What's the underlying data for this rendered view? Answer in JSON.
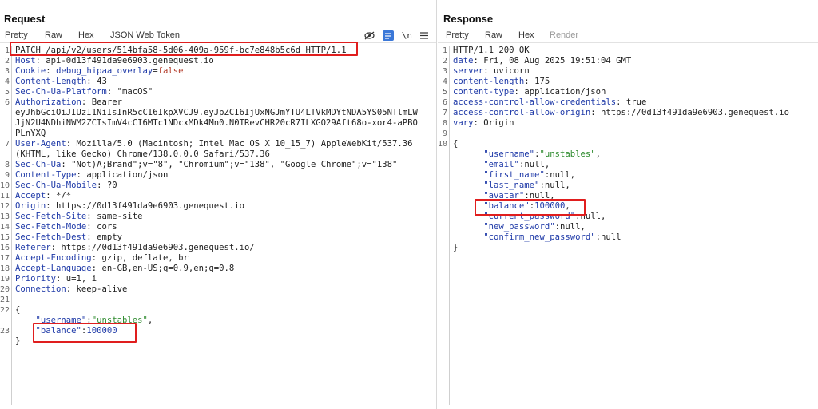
{
  "request": {
    "title": "Request",
    "tabs": [
      "Pretty",
      "Raw",
      "Hex",
      "JSON Web Token"
    ],
    "active_tab": "Pretty",
    "tools": {
      "hide_icon": "eye-off-icon",
      "wrap_icon": "wrap-icon",
      "newline_label": "\\n",
      "menu_icon": "hamburger-icon"
    },
    "lines": [
      {
        "n": "1",
        "text": "PATCH /api/v2/users/514bfa58-5d06-409a-959f-bc7e848b5c6d HTTP/1.1"
      },
      {
        "n": "2",
        "k": "Host",
        "v": " api-0d13f491da9e6903.genequest.io"
      },
      {
        "n": "3",
        "k": "Cookie",
        "v": " ",
        "ck": "debug_hipaa_overlay",
        "cv": "false"
      },
      {
        "n": "4",
        "k": "Content-Length",
        "v": " 43"
      },
      {
        "n": "5",
        "k": "Sec-Ch-Ua-Platform",
        "v": " \"macOS\""
      },
      {
        "n": "6",
        "k": "Authorization",
        "v": " Bearer"
      },
      {
        "n": "",
        "text": "eyJhbGciOiJIUzI1NiIsInR5cCI6IkpXVCJ9.eyJpZCI6IjUxNGJmYTU4LTVkMDYtNDA5YS05NTlmLW"
      },
      {
        "n": "",
        "text": "JjN2U4NDhiNWM2ZCIsImV4cCI6MTc1NDcxMDk4Mn0.N0TRevCHR20cR7ILXGO29Aft68o-xor4-aPBO"
      },
      {
        "n": "",
        "text": "PLnYXQ"
      },
      {
        "n": "7",
        "k": "User-Agent",
        "v": " Mozilla/5.0 (Macintosh; Intel Mac OS X 10_15_7) AppleWebKit/537.36"
      },
      {
        "n": "",
        "text": "(KHTML, like Gecko) Chrome/138.0.0.0 Safari/537.36"
      },
      {
        "n": "8",
        "k": "Sec-Ch-Ua",
        "v": " \"Not)A;Brand\";v=\"8\", \"Chromium\";v=\"138\", \"Google Chrome\";v=\"138\""
      },
      {
        "n": "9",
        "k": "Content-Type",
        "v": " application/json"
      },
      {
        "n": "10",
        "k": "Sec-Ch-Ua-Mobile",
        "v": " ?0"
      },
      {
        "n": "11",
        "k": "Accept",
        "v": " */*"
      },
      {
        "n": "12",
        "k": "Origin",
        "v": " https://0d13f491da9e6903.genequest.io"
      },
      {
        "n": "13",
        "k": "Sec-Fetch-Site",
        "v": " same-site"
      },
      {
        "n": "14",
        "k": "Sec-Fetch-Mode",
        "v": " cors"
      },
      {
        "n": "15",
        "k": "Sec-Fetch-Dest",
        "v": " empty"
      },
      {
        "n": "16",
        "k": "Referer",
        "v": " https://0d13f491da9e6903.genequest.io/"
      },
      {
        "n": "17",
        "k": "Accept-Encoding",
        "v": " gzip, deflate, br"
      },
      {
        "n": "18",
        "k": "Accept-Language",
        "v": " en-GB,en-US;q=0.9,en;q=0.8"
      },
      {
        "n": "19",
        "k": "Priority",
        "v": " u=1, i"
      },
      {
        "n": "20",
        "k": "Connection",
        "v": " keep-alive"
      },
      {
        "n": "21",
        "text": ""
      },
      {
        "n": "22",
        "text": "{"
      },
      {
        "n": "",
        "jk": "\"username\"",
        "js": "\"unstables\"",
        "tail": ",",
        "indent": "    "
      },
      {
        "n": "23",
        "jk": "\"balance\"",
        "jn": "100000",
        "indent": "    "
      },
      {
        "n": "",
        "text": "}"
      }
    ]
  },
  "response": {
    "title": "Response",
    "tabs": [
      "Pretty",
      "Raw",
      "Hex",
      "Render"
    ],
    "active_tab": "Pretty",
    "lines": [
      {
        "n": "1",
        "text": "HTTP/1.1 200 OK"
      },
      {
        "n": "2",
        "k": "date",
        "v": " Fri, 08 Aug 2025 19:51:04 GMT"
      },
      {
        "n": "3",
        "k": "server",
        "v": " uvicorn"
      },
      {
        "n": "4",
        "k": "content-length",
        "v": " 175"
      },
      {
        "n": "5",
        "k": "content-type",
        "v": " application/json"
      },
      {
        "n": "6",
        "k": "access-control-allow-credentials",
        "v": " true"
      },
      {
        "n": "7",
        "k": "access-control-allow-origin",
        "v": " https://0d13f491da9e6903.genequest.io"
      },
      {
        "n": "8",
        "k": "vary",
        "v": " Origin"
      },
      {
        "n": "9",
        "text": ""
      },
      {
        "n": "10",
        "text": "{"
      },
      {
        "n": "",
        "jk": "\"username\"",
        "js": "\"unstables\"",
        "tail": ",",
        "indent": "      "
      },
      {
        "n": "",
        "jk": "\"email\"",
        "jnull": "null",
        "tail": ",",
        "indent": "      "
      },
      {
        "n": "",
        "jk": "\"first_name\"",
        "jnull": "null",
        "tail": ",",
        "indent": "      "
      },
      {
        "n": "",
        "jk": "\"last_name\"",
        "jnull": "null",
        "tail": ",",
        "indent": "      "
      },
      {
        "n": "",
        "jk": "\"avatar\"",
        "jnull": "null",
        "tail": ",",
        "indent": "      "
      },
      {
        "n": "",
        "jk": "\"balance\"",
        "jn": "100000",
        "tail": ",",
        "indent": "      "
      },
      {
        "n": "",
        "jk": "\"current_password\"",
        "jnull": "null",
        "tail": ",",
        "indent": "      "
      },
      {
        "n": "",
        "jk": "\"new_password\"",
        "jnull": "null",
        "tail": ",",
        "indent": "      "
      },
      {
        "n": "",
        "jk": "\"confirm_new_password\"",
        "jnull": "null",
        "indent": "      "
      },
      {
        "n": "",
        "text": "}"
      }
    ]
  },
  "colors": {
    "accent": "#e8562a",
    "highlight": "#e01e1e",
    "key": "#1f3aa8",
    "string": "#2e8b2e"
  }
}
